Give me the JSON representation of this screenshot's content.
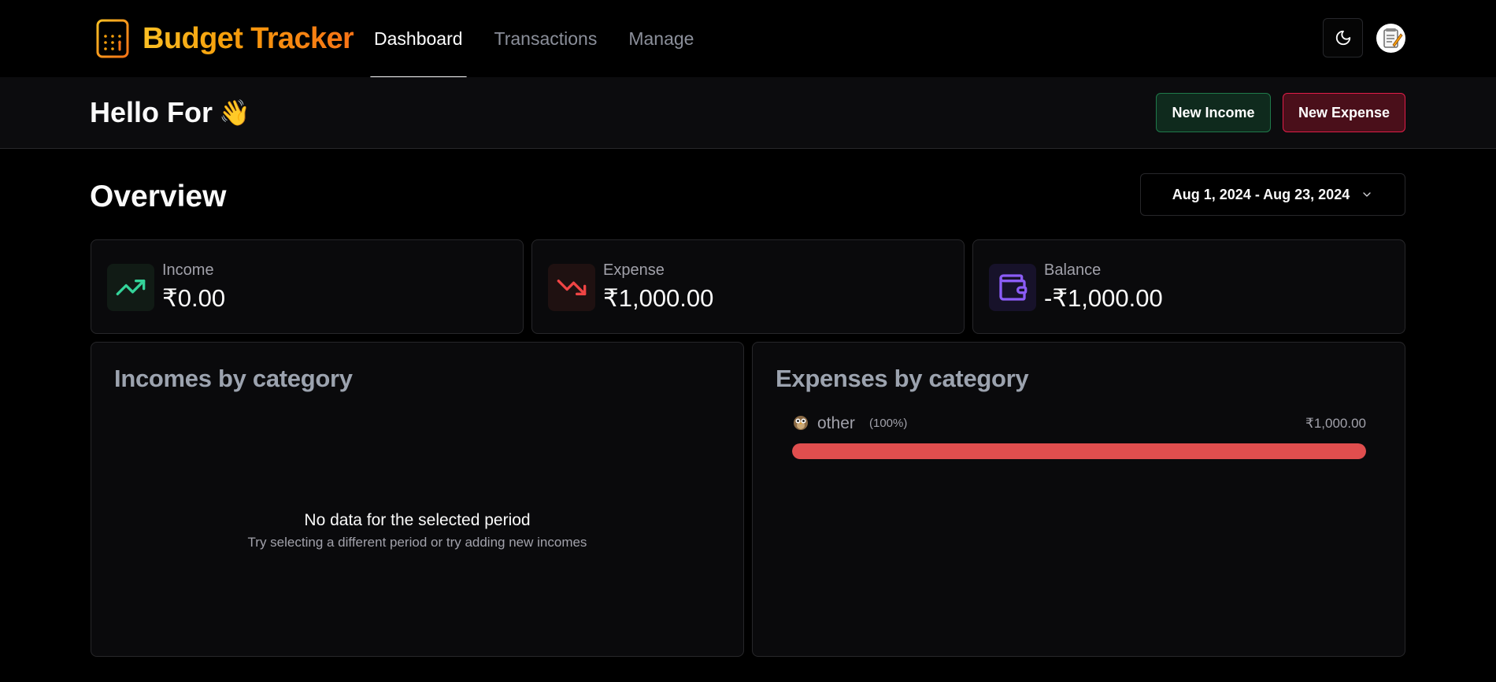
{
  "app": {
    "name": "Budget Tracker"
  },
  "nav": [
    {
      "label": "Dashboard",
      "active": true
    },
    {
      "label": "Transactions",
      "active": false
    },
    {
      "label": "Manage",
      "active": false
    }
  ],
  "header": {
    "theme_icon": "moon-icon",
    "avatar_icon": "notepad-avatar"
  },
  "greeting": {
    "text": "Hello For",
    "emoji": "👋"
  },
  "actions": {
    "new_income": "New Income",
    "new_expense": "New Expense"
  },
  "overview": {
    "title": "Overview",
    "date_range": "Aug 1, 2024 - Aug 23, 2024"
  },
  "stats": {
    "income": {
      "label": "Income",
      "value": "₹0.00",
      "icon": "trending-up-icon",
      "color": "#34d399"
    },
    "expense": {
      "label": "Expense",
      "value": "₹1,000.00",
      "icon": "trending-down-icon",
      "color": "#ef4444"
    },
    "balance": {
      "label": "Balance",
      "value": "-₹1,000.00",
      "icon": "wallet-icon",
      "color": "#8b5cf6"
    }
  },
  "incomes_by_category": {
    "title": "Incomes by category",
    "empty_title": "No data for the selected period",
    "empty_subtitle": "Try selecting a different period or try adding new incomes"
  },
  "expenses_by_category": {
    "title": "Expenses by category",
    "items": [
      {
        "emoji": "🦉",
        "name": "other",
        "percent": "(100%)",
        "amount": "₹1,000.00",
        "fill_percent": 100,
        "color": "#e04e4e"
      }
    ]
  }
}
